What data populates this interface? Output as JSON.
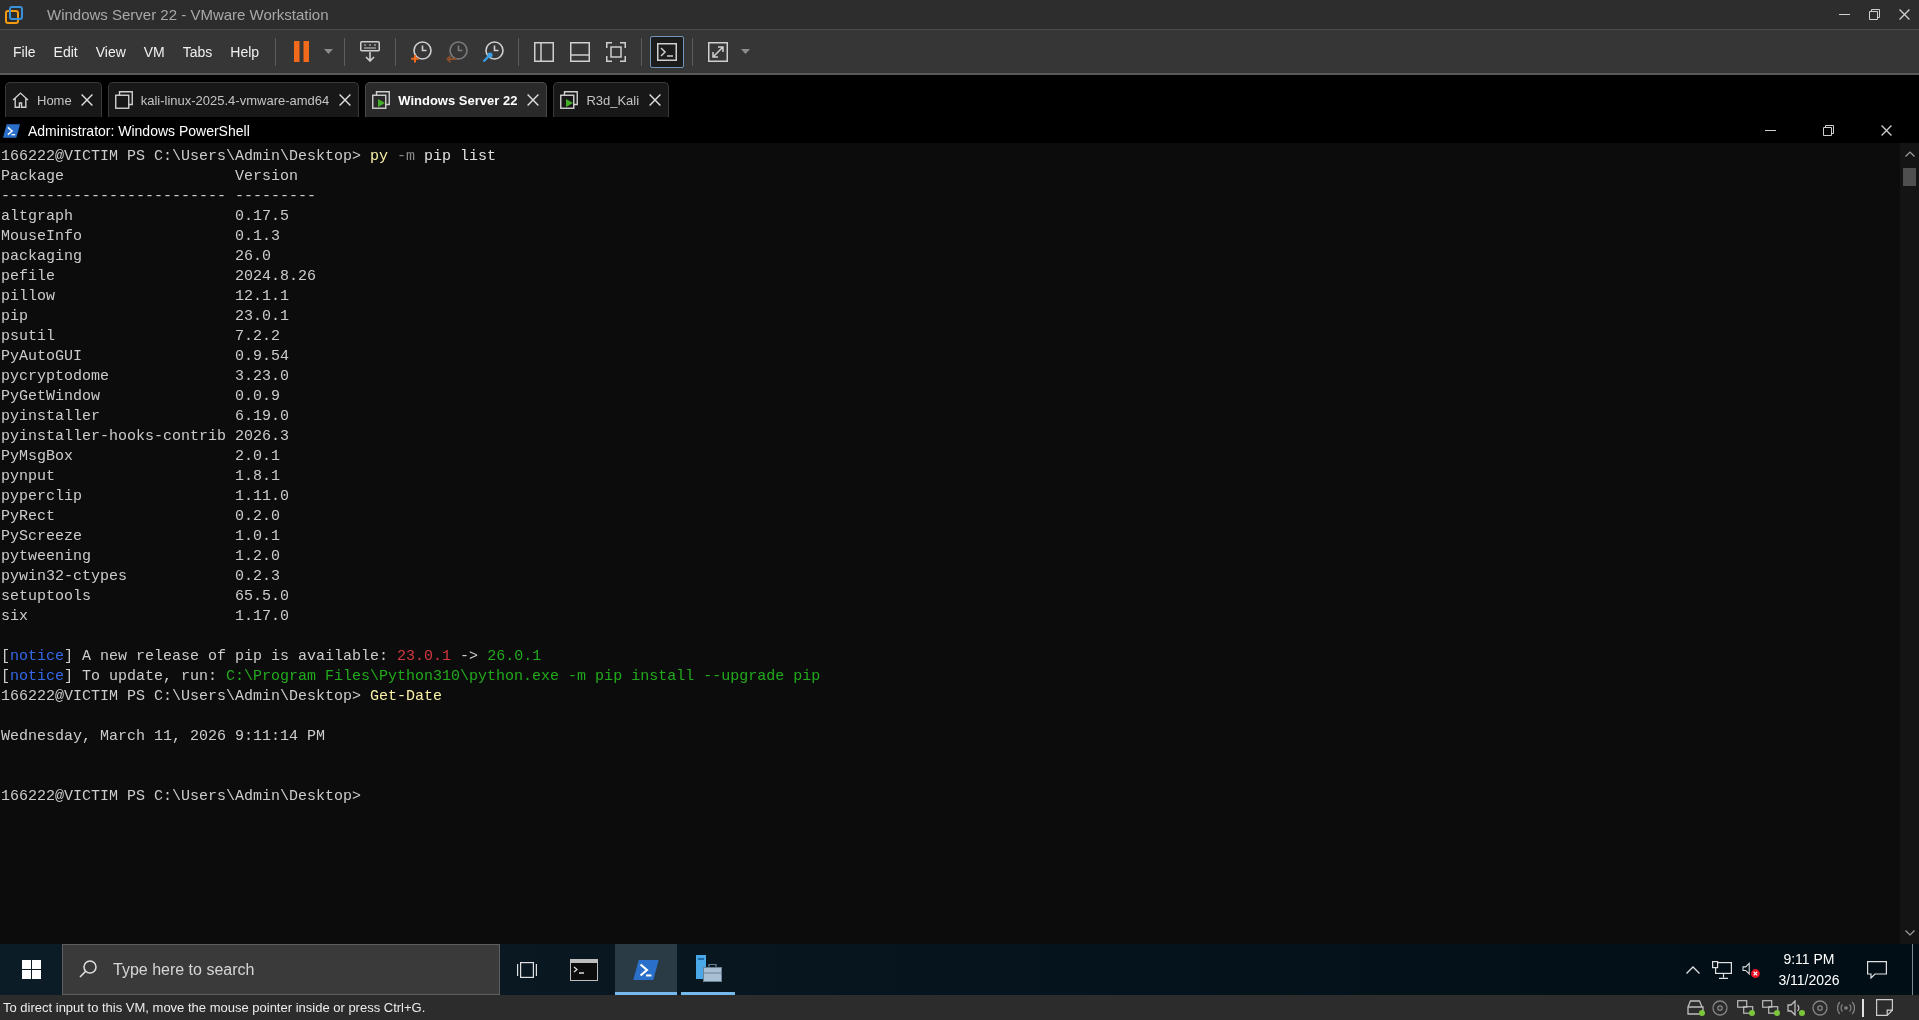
{
  "vmware": {
    "title": "Windows Server 22 - VMware Workstation",
    "menu": [
      "File",
      "Edit",
      "View",
      "VM",
      "Tabs",
      "Help"
    ],
    "toolbar": [
      {
        "buttons": [
          {
            "kind": "pause",
            "selected": false,
            "disabled": false
          },
          {
            "kind": "dropdown",
            "selected": false,
            "disabled": false
          }
        ]
      },
      {
        "buttons": [
          {
            "kind": "send-keys",
            "selected": false,
            "disabled": false
          }
        ]
      },
      {
        "buttons": [
          {
            "kind": "snapshot-take",
            "selected": false,
            "disabled": false
          },
          {
            "kind": "snapshot-revert",
            "selected": false,
            "disabled": true
          },
          {
            "kind": "snapshot-manager",
            "selected": false,
            "disabled": false
          }
        ]
      },
      {
        "buttons": [
          {
            "kind": "library",
            "selected": false,
            "disabled": false
          },
          {
            "kind": "thumbnails",
            "selected": false,
            "disabled": false
          },
          {
            "kind": "full-screen",
            "selected": false,
            "disabled": false
          }
        ]
      },
      {
        "buttons": [
          {
            "kind": "console",
            "selected": true,
            "disabled": false
          }
        ]
      },
      {
        "buttons": [
          {
            "kind": "stretch",
            "selected": false,
            "disabled": false
          },
          {
            "kind": "dropdown",
            "selected": false,
            "disabled": false
          }
        ]
      }
    ],
    "tabs": [
      {
        "kind": "home",
        "label": "Home",
        "selected": false
      },
      {
        "kind": "vm",
        "label": "kali-linux-2025.4-vmware-amd64",
        "selected": false,
        "running": false
      },
      {
        "kind": "vm",
        "label": "Windows Server 22",
        "selected": true,
        "running": true
      },
      {
        "kind": "vm",
        "label": "R3d_Kali",
        "selected": false,
        "running": true
      }
    ]
  },
  "guest": {
    "window": {
      "title": "Administrator: Windows PowerShell"
    },
    "terminal": [
      {
        "kind": "line",
        "segments": [
          {
            "kind": "prompt",
            "text": "166222@VICTIM PS C:\\Users\\Admin\\Desktop> "
          },
          {
            "kind": "command",
            "text": "py"
          },
          {
            "kind": "parameter",
            "text": " -m"
          },
          {
            "kind": "argument",
            "text": " pip list"
          }
        ]
      },
      {
        "kind": "table",
        "columns": [
          "Package",
          "Version"
        ],
        "rules": [
          "-------------------------",
          "---------"
        ],
        "rows": [
          {
            "package": "altgraph",
            "version": "0.17.5"
          },
          {
            "package": "MouseInfo",
            "version": "0.1.3"
          },
          {
            "package": "packaging",
            "version": "26.0"
          },
          {
            "package": "pefile",
            "version": "2024.8.26"
          },
          {
            "package": "pillow",
            "version": "12.1.1"
          },
          {
            "package": "pip",
            "version": "23.0.1"
          },
          {
            "package": "psutil",
            "version": "7.2.2"
          },
          {
            "package": "PyAutoGUI",
            "version": "0.9.54"
          },
          {
            "package": "pycryptodome",
            "version": "3.23.0"
          },
          {
            "package": "PyGetWindow",
            "version": "0.0.9"
          },
          {
            "package": "pyinstaller",
            "version": "6.19.0"
          },
          {
            "package": "pyinstaller-hooks-contrib",
            "version": "2026.3"
          },
          {
            "package": "PyMsgBox",
            "version": "2.0.1"
          },
          {
            "package": "pynput",
            "version": "1.8.1"
          },
          {
            "package": "pyperclip",
            "version": "1.11.0"
          },
          {
            "package": "PyRect",
            "version": "0.2.0"
          },
          {
            "package": "PyScreeze",
            "version": "1.0.1"
          },
          {
            "package": "pytweening",
            "version": "1.2.0"
          },
          {
            "package": "pywin32-ctypes",
            "version": "0.2.3"
          },
          {
            "package": "setuptools",
            "version": "65.5.0"
          },
          {
            "package": "six",
            "version": "1.17.0"
          }
        ]
      },
      {
        "kind": "blank"
      },
      {
        "kind": "line",
        "segments": [
          {
            "kind": "plain",
            "text": "["
          },
          {
            "kind": "notice",
            "text": "notice"
          },
          {
            "kind": "plain",
            "text": "] A new release of pip is available: "
          },
          {
            "kind": "old",
            "text": "23.0.1"
          },
          {
            "kind": "plain",
            "text": " -> "
          },
          {
            "kind": "new",
            "text": "26.0.1"
          }
        ]
      },
      {
        "kind": "line",
        "segments": [
          {
            "kind": "plain",
            "text": "["
          },
          {
            "kind": "notice",
            "text": "notice"
          },
          {
            "kind": "plain",
            "text": "] To update, run: "
          },
          {
            "kind": "path",
            "text": "C:\\Program Files\\Python310\\python.exe -m pip install --upgrade pip"
          }
        ]
      },
      {
        "kind": "line",
        "segments": [
          {
            "kind": "prompt",
            "text": "166222@VICTIM PS C:\\Users\\Admin\\Desktop> "
          },
          {
            "kind": "command",
            "text": "Get-Date"
          }
        ]
      },
      {
        "kind": "blank"
      },
      {
        "kind": "line",
        "segments": [
          {
            "kind": "plain",
            "text": "Wednesday, March 11, 2026 9:11:14 PM"
          }
        ]
      },
      {
        "kind": "blank"
      },
      {
        "kind": "blank"
      },
      {
        "kind": "line",
        "segments": [
          {
            "kind": "prompt",
            "text": "166222@VICTIM PS C:\\Users\\Admin\\Desktop>"
          }
        ]
      }
    ],
    "taskbar": {
      "search": {
        "placeholder": "Type here to search"
      },
      "apps": [
        {
          "kind": "console",
          "selected": false,
          "running": false
        },
        {
          "kind": "powershell",
          "selected": true,
          "running": true
        },
        {
          "kind": "server-manager",
          "selected": false,
          "running": true
        }
      ],
      "clock": {
        "time": "9:11 PM",
        "date": "3/11/2026"
      }
    }
  },
  "status_bar": {
    "message": "To direct input to this VM, move the mouse pointer inside or press Ctrl+G.",
    "devices": [
      {
        "kind": "disk",
        "active": true
      },
      {
        "kind": "disc",
        "active": false
      },
      {
        "kind": "network",
        "active": true
      },
      {
        "kind": "network",
        "active": true
      },
      {
        "kind": "sound",
        "active": true
      },
      {
        "kind": "disc",
        "active": false
      },
      {
        "kind": "wireless",
        "active": false
      }
    ]
  }
}
